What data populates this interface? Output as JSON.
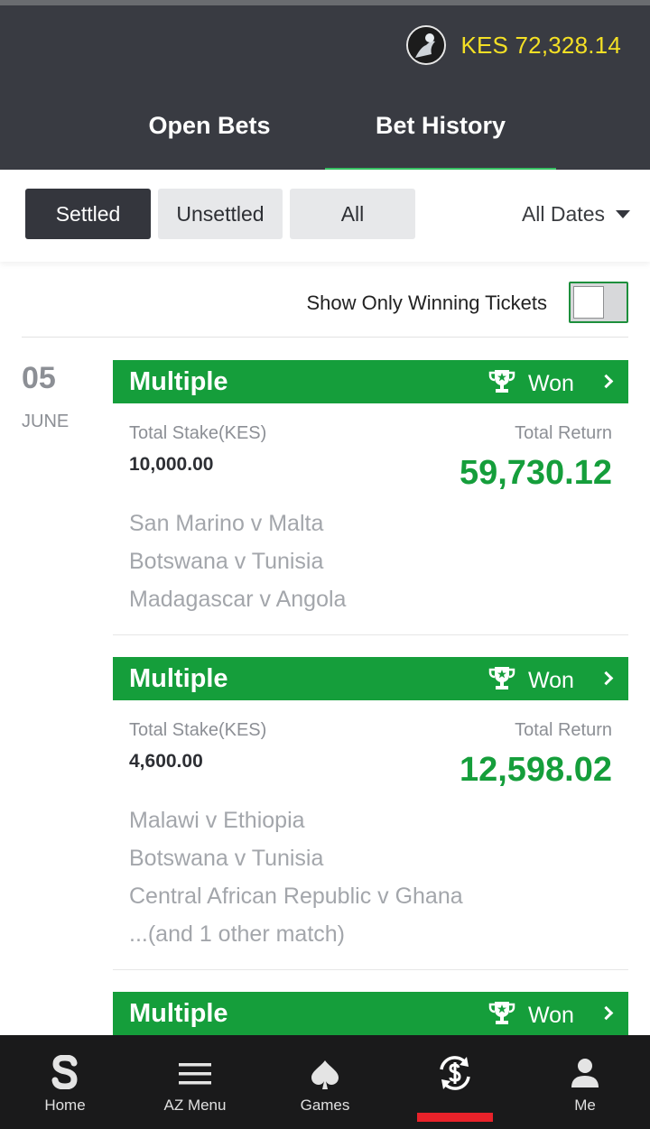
{
  "account": {
    "balance": "KES 72,328.14"
  },
  "tabs": [
    {
      "label": "Open Bets",
      "active": false
    },
    {
      "label": "Bet History",
      "active": true
    }
  ],
  "filters": {
    "settled": "Settled",
    "unsettled": "Unsettled",
    "all": "All",
    "dates": "All Dates",
    "selected": "Settled"
  },
  "winning_toggle": {
    "label": "Show Only Winning Tickets",
    "checked": false
  },
  "date": {
    "day": "05",
    "month": "JUNE"
  },
  "bets": [
    {
      "type": "Multiple",
      "status": "Won",
      "stake_label": "Total Stake(KES)",
      "stake": "10,000.00",
      "return_label": "Total Return",
      "total_return": "59,730.12",
      "matches": [
        "San Marino v Malta",
        "Botswana v Tunisia",
        "Madagascar v Angola"
      ]
    },
    {
      "type": "Multiple",
      "status": "Won",
      "stake_label": "Total Stake(KES)",
      "stake": "4,600.00",
      "return_label": "Total Return",
      "total_return": "12,598.02",
      "matches": [
        "Malawi v Ethiopia",
        "Botswana v Tunisia",
        "Central African Republic v Ghana",
        "...(and 1 other match)"
      ]
    },
    {
      "type": "Multiple",
      "status": "Won"
    }
  ],
  "bottom_nav": [
    {
      "label": "Home",
      "icon": "sportpesa-s-icon"
    },
    {
      "label": "AZ Menu",
      "icon": "hamburger-menu-icon"
    },
    {
      "label": "Games",
      "icon": "spade-icon"
    },
    {
      "label": "",
      "icon": "bet-history-refresh-icon",
      "active": true
    },
    {
      "label": "Me",
      "icon": "user-icon"
    }
  ],
  "colors": {
    "header_bg": "#393b42",
    "balance": "#f4e025",
    "accent_green": "#159e3b",
    "tab_underline": "#37c163",
    "nav_active": "#e8222a"
  }
}
